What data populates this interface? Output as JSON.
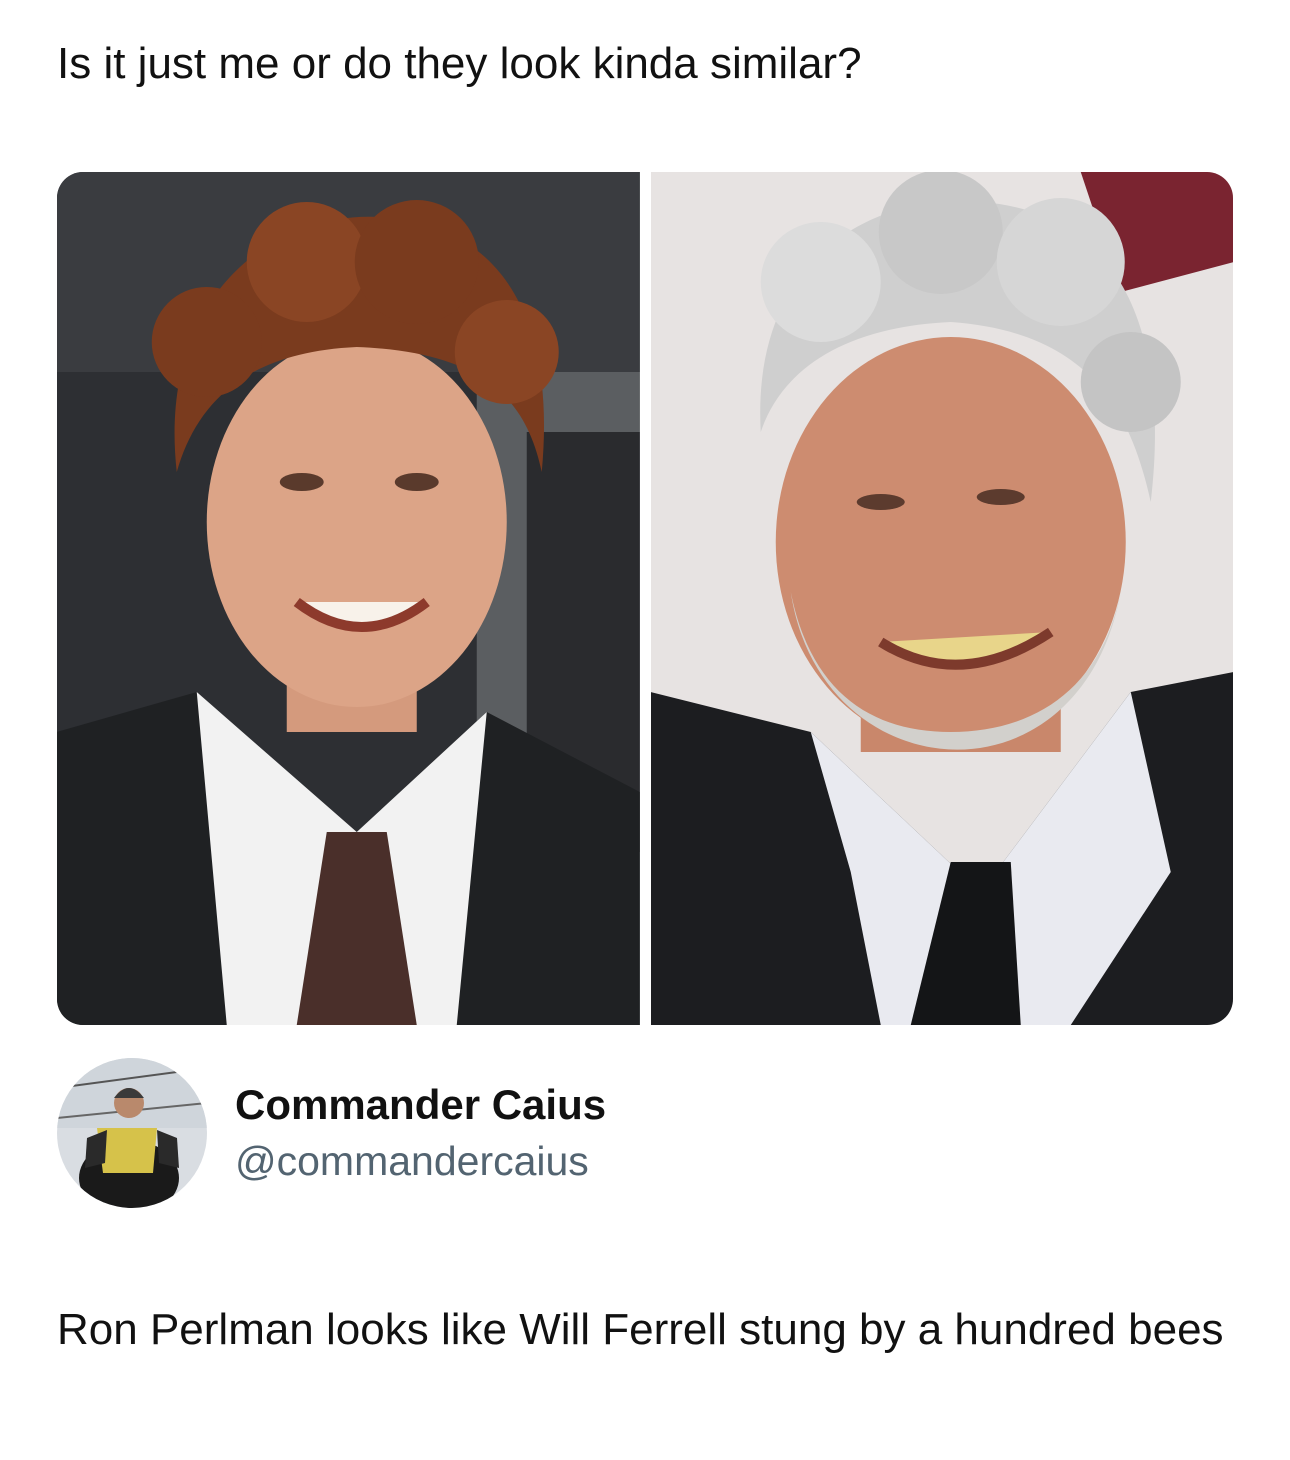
{
  "quoted": {
    "text": "Is it just me or do they look kinda similar?"
  },
  "media": {
    "photos": [
      {
        "icon": "will-ferrell-photo"
      },
      {
        "icon": "ron-perlman-photo"
      }
    ]
  },
  "author": {
    "display_name": "Commander Caius",
    "handle": "@commandercaius",
    "avatar_icon": "avatar-photo"
  },
  "tweet": {
    "text": "Ron Perlman looks like Will Ferrell stung by a hundred bees"
  }
}
